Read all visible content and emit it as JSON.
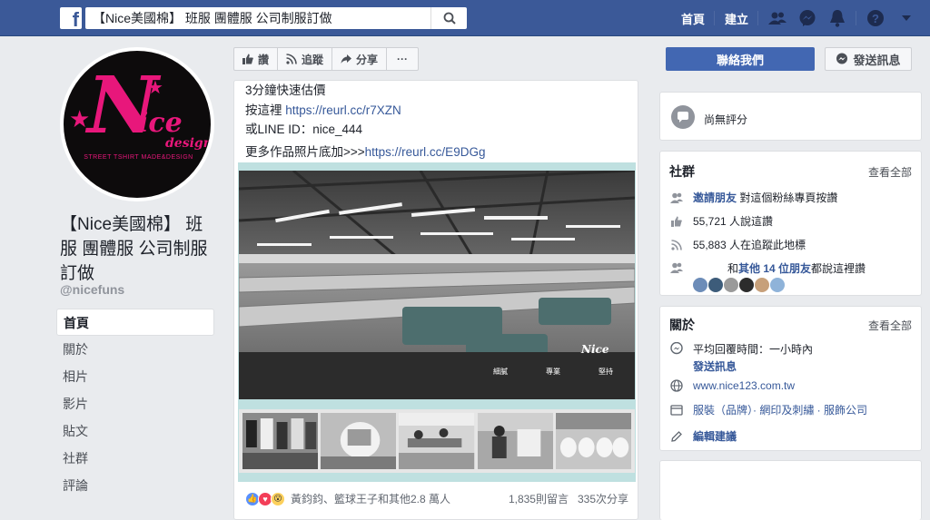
{
  "topbar": {
    "logo": "f",
    "search_value": "【Nice美國棉】 班服 團體服 公司制服訂做",
    "home": "首頁",
    "create": "建立",
    "icons": [
      "friends-icon",
      "messenger-icon",
      "bell-icon",
      "help-icon",
      "caret-down-icon"
    ]
  },
  "profile": {
    "logo_main": "N",
    "logo_rest": "ice",
    "logo_sub": "design",
    "logo_tag": "STREET TSHIRT MADE&DESIGN",
    "name": "【Nice美國棉】 班服 團體服 公司制服訂做",
    "handle": "@nicefuns"
  },
  "left_nav": [
    "首頁",
    "關於",
    "相片",
    "影片",
    "貼文",
    "社群",
    "評論"
  ],
  "actions": {
    "like": "讚",
    "follow": "追蹤",
    "share": "分享",
    "more": "···",
    "contact": "聯絡我們",
    "message": "發送訊息"
  },
  "post": {
    "line1": "3分鐘快速估價",
    "line2_prefix": "按這裡 ",
    "line2_link": "https://reurl.cc/r7XZN",
    "line3": "或LINE ID：nice_444",
    "line4_prefix": "更多作品照片底加>>>",
    "line4_link": "https://reurl.cc/E9DGg",
    "photo_watermark": "Nice",
    "photo_captions": [
      "細膩",
      "專業",
      "堅持"
    ],
    "reactions_text": "黃鈞鈞、籃球王子和其他2.8 萬人",
    "comments": "1,835則留言",
    "shares": "335次分享"
  },
  "rating_card": {
    "text": "尚無評分"
  },
  "community_card": {
    "title": "社群",
    "see_all": "查看全部",
    "invite_link": "邀請朋友",
    "invite_text": " 對這個粉絲專頁按讚",
    "likes": "55,721 人說這讚",
    "follows": "55,883 人在追蹤此地標",
    "friends_prefix": "和",
    "friends_link": "其他 14 位朋友",
    "friends_suffix": "都說這裡讚"
  },
  "about_card": {
    "title": "關於",
    "see_all": "查看全部",
    "response": "平均回覆時間：一小時內",
    "send_message": "發送訊息",
    "website": "www.nice123.com.tw",
    "categories": "服裝（品牌）· 網印及刺繡 · 服飾公司",
    "suggest_edits": "編輯建議"
  },
  "colors": {
    "brand": "#3b5998",
    "button_blue": "#4267b2",
    "link": "#365899",
    "logo_pink": "#e8177b"
  }
}
